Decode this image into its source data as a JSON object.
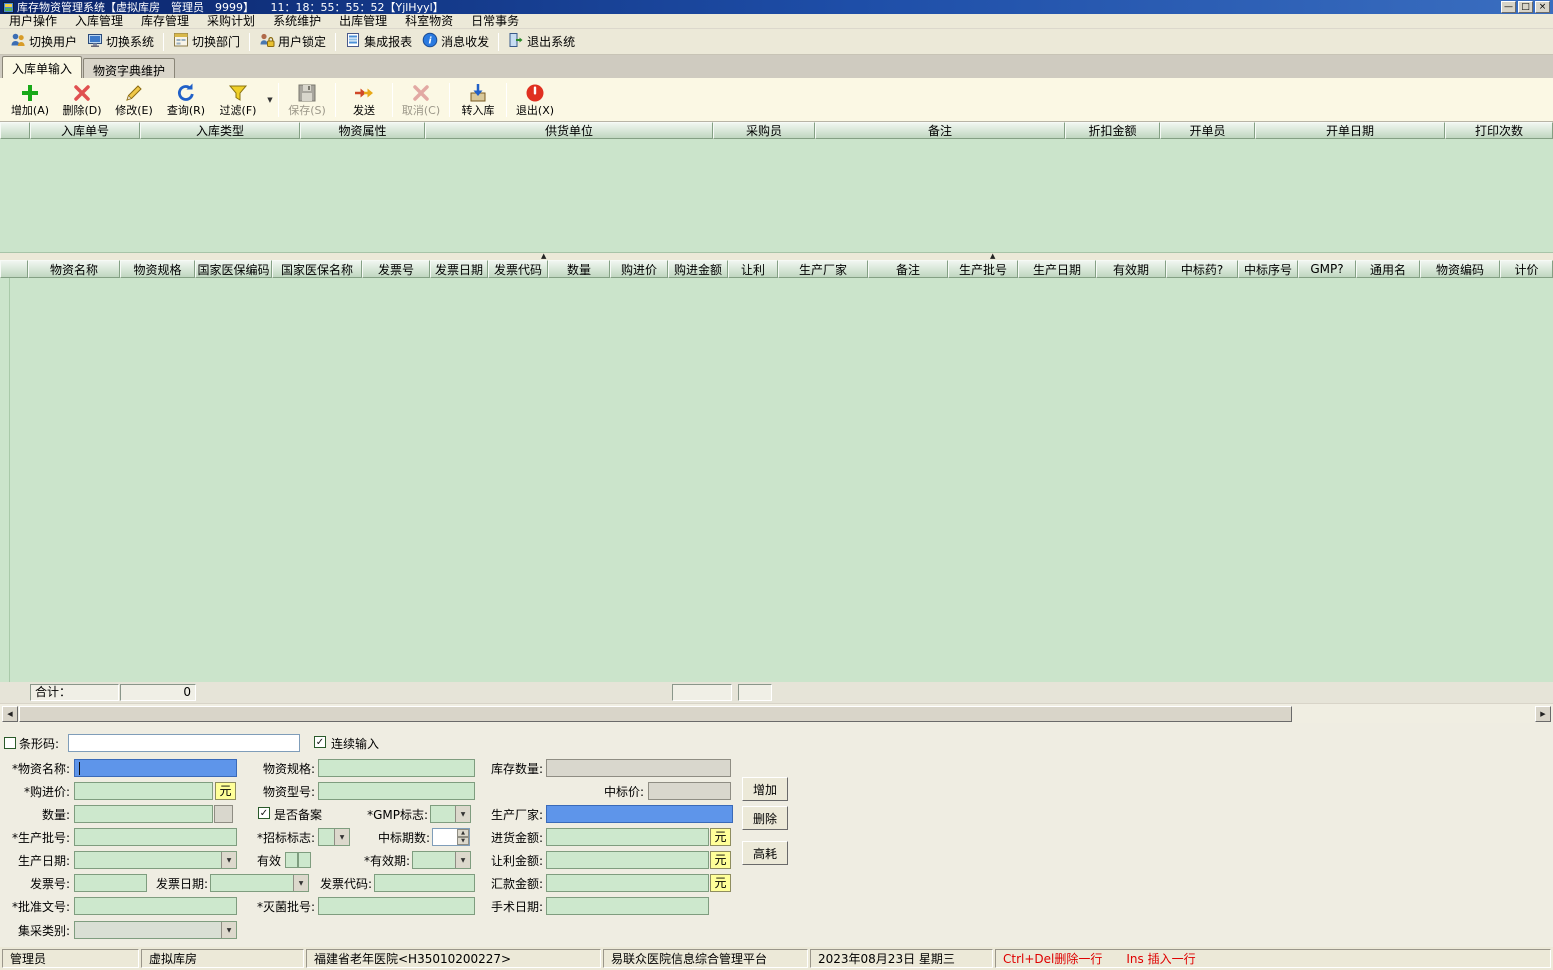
{
  "window": {
    "title": "库存物资管理系统【虚拟库房　管理员　9999】　　11：18：55：55：52【YjlHyyl】",
    "minimize": "—",
    "maximize": "□",
    "close": "×"
  },
  "menubar": {
    "items": [
      "用户操作",
      "入库管理",
      "库存管理",
      "采购计划",
      "系统维护",
      "出库管理",
      "科室物资",
      "日常事务"
    ]
  },
  "main_toolbar": {
    "items": [
      {
        "label": "切换用户",
        "icon": "switch-user-icon"
      },
      {
        "label": "切换系统",
        "icon": "switch-system-icon"
      },
      {
        "label": "切换部门",
        "icon": "switch-department-icon"
      },
      {
        "label": "用户锁定",
        "icon": "user-lock-icon"
      },
      {
        "label": "集成报表",
        "icon": "integrated-report-icon"
      },
      {
        "label": "消息收发",
        "icon": "message-icon"
      },
      {
        "label": "退出系统",
        "icon": "exit-system-icon"
      }
    ]
  },
  "tabs": {
    "items": [
      {
        "label": "入库单输入",
        "active": true
      },
      {
        "label": "物资字典维护",
        "active": false
      }
    ]
  },
  "action_toolbar": {
    "items": [
      {
        "label": "增加(A)",
        "icon": "add-icon",
        "enabled": true,
        "dropdown": false
      },
      {
        "label": "删除(D)",
        "icon": "delete-icon",
        "enabled": true,
        "dropdown": false
      },
      {
        "label": "修改(E)",
        "icon": "edit-icon",
        "enabled": true,
        "dropdown": false
      },
      {
        "label": "查询(R)",
        "icon": "query-icon",
        "enabled": true,
        "dropdown": false
      },
      {
        "label": "过滤(F)",
        "icon": "filter-icon",
        "enabled": true,
        "dropdown": true
      },
      {
        "label": "保存(S)",
        "icon": "save-icon",
        "enabled": false,
        "dropdown": false
      },
      {
        "label": "发送",
        "icon": "send-icon",
        "enabled": true,
        "dropdown": false
      },
      {
        "label": "取消(C)",
        "icon": "cancel-icon",
        "enabled": false,
        "dropdown": false
      },
      {
        "label": "转入库",
        "icon": "transfer-icon",
        "enabled": true,
        "dropdown": false
      },
      {
        "label": "退出(X)",
        "icon": "quit-icon",
        "enabled": true,
        "dropdown": false
      }
    ]
  },
  "master_table": {
    "columns": [
      "入库单号",
      "入库类型",
      "物资属性",
      "供货单位",
      "采购员",
      "备注",
      "折扣金额",
      "开单员",
      "开单日期",
      "打印次数"
    ],
    "rows": []
  },
  "detail_table": {
    "columns": [
      "物资名称",
      "物资规格",
      "国家医保编码",
      "国家医保名称",
      "发票号",
      "发票日期",
      "发票代码",
      "数量",
      "购进价",
      "购进金额",
      "让利",
      "生产厂家",
      "备注",
      "生产批号",
      "生产日期",
      "有效期",
      "中标药?",
      "中标序号",
      "GMP?",
      "通用名",
      "物资编码",
      "计价"
    ],
    "rows": []
  },
  "summary": {
    "label": "合计：",
    "value": "0"
  },
  "form": {
    "currency_unit": "元",
    "barcode": {
      "label": "条形码:",
      "value": "",
      "checked": false
    },
    "continuous_input": {
      "label": "连续输入",
      "checked": true
    },
    "material_name": {
      "label": "*物资名称:",
      "value": ""
    },
    "material_spec": {
      "label": "物资规格:",
      "value": ""
    },
    "stock_quantity": {
      "label": "库存数量:",
      "value": ""
    },
    "purchase_price": {
      "label": "*购进价:",
      "value": ""
    },
    "material_model": {
      "label": "物资型号:",
      "value": ""
    },
    "bid_price": {
      "label": "中标价:",
      "value": ""
    },
    "quantity": {
      "label": "数量:",
      "value": ""
    },
    "is_filed": {
      "label": "是否备案",
      "checked": true
    },
    "gmp_flag": {
      "label": "*GMP标志:",
      "value": ""
    },
    "manufacturer": {
      "label": "生产厂家:",
      "value": ""
    },
    "production_batch": {
      "label": "*生产批号:",
      "value": ""
    },
    "bid_flag": {
      "label": "*招标标志:",
      "value": ""
    },
    "bid_period": {
      "label": "中标期数:",
      "value": ""
    },
    "purchase_amount": {
      "label": "进货金额:",
      "value": ""
    },
    "production_date": {
      "label": "生产日期:",
      "value": ""
    },
    "valid": {
      "label": "有效",
      "value1": "",
      "value2": ""
    },
    "expiry_date": {
      "label": "*有效期:",
      "value": ""
    },
    "rebate_amount": {
      "label": "让利金额:",
      "value": ""
    },
    "invoice_no": {
      "label": "发票号:",
      "value": ""
    },
    "invoice_date": {
      "label": "发票日期:",
      "value": ""
    },
    "invoice_code": {
      "label": "发票代码:",
      "value": ""
    },
    "remittance_amount": {
      "label": "汇款金额:",
      "value": ""
    },
    "approval_no": {
      "label": "*批准文号:",
      "value": ""
    },
    "sterilization_batch": {
      "label": "*灭菌批号:",
      "value": ""
    },
    "surgery_date": {
      "label": "手术日期:",
      "value": ""
    },
    "collect_category": {
      "label": "集采类别:",
      "value": ""
    },
    "buttons": {
      "add": "增加",
      "delete": "删除",
      "high_consumable": "高耗"
    }
  },
  "statusbar": {
    "segments": [
      "管理员",
      "虚拟库房",
      "福建省老年医院<H35010200227>",
      "易联众医院信息综合管理平台",
      "2023年08月23日 星期三"
    ],
    "shortcut_hint": "Ctrl+Del删除一行　　Ins 插入一行"
  },
  "colors": {
    "titlebar_blue": "#0a246a",
    "grid_green": "#cbe4cb",
    "input_green": "#cde8cd",
    "focused_input_blue": "#5e95ea",
    "unit_yellow": "#ffff99",
    "panel_cream": "#fbf8e4",
    "hint_red": "#de0000"
  }
}
